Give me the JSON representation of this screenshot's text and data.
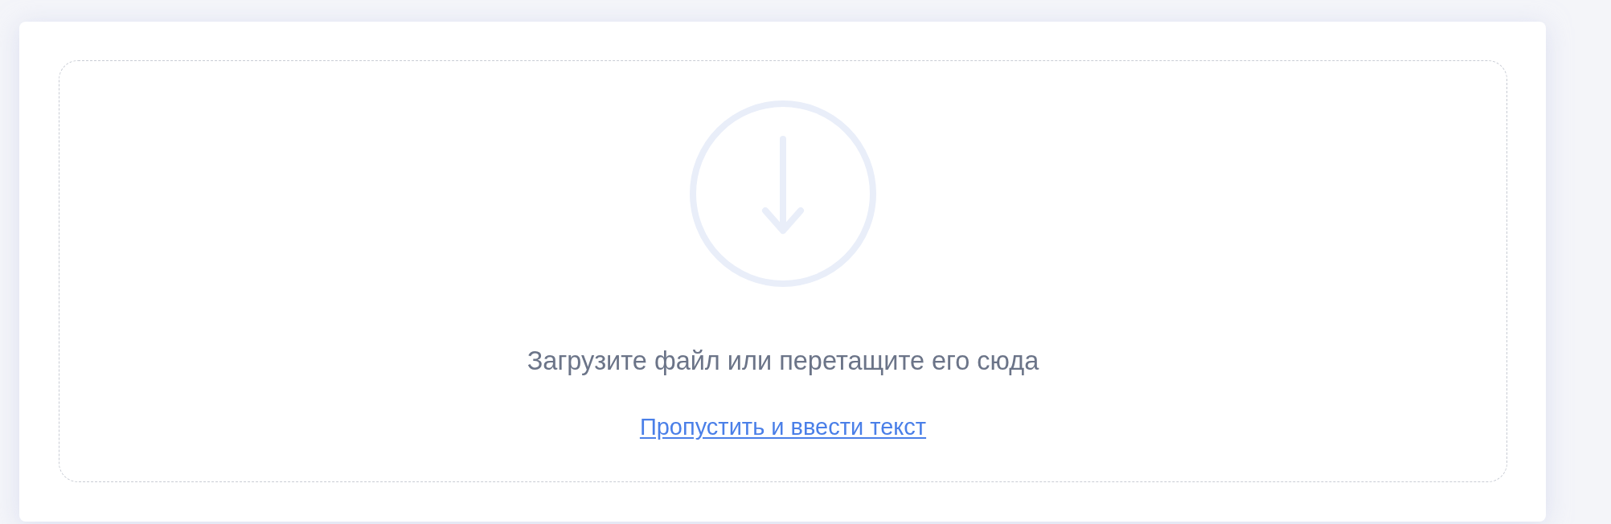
{
  "upload_zone": {
    "message": "Загрузите файл или перетащите его сюда",
    "skip_link": "Пропустить и ввести текст"
  }
}
